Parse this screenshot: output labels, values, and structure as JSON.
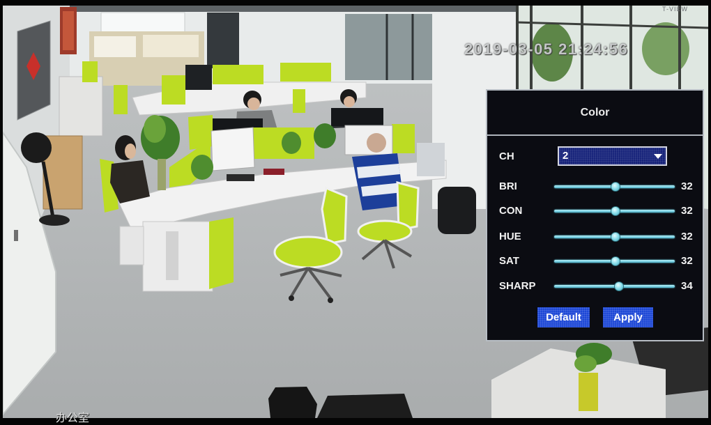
{
  "device": {
    "brand": "T-VIEW"
  },
  "osd": {
    "timestamp": "2019-03-05 21:24:56",
    "channel_name": "办公室"
  },
  "color_panel": {
    "title": "Color",
    "channel": {
      "label": "CH",
      "selected": "2"
    },
    "sliders": [
      {
        "label": "BRI",
        "value": 32
      },
      {
        "label": "CON",
        "value": 32
      },
      {
        "label": "HUE",
        "value": 32
      },
      {
        "label": "SAT",
        "value": 32
      },
      {
        "label": "SHARP",
        "value": 34
      }
    ],
    "buttons": {
      "default": "Default",
      "apply": "Apply"
    }
  },
  "icons": {
    "dropdown": "chevron-down-icon",
    "slider_handle": "slider-knob"
  },
  "colors": {
    "panel_background": "#0b0c12",
    "button_blue": "#1d47d6",
    "dropdown_navy": "#16227a",
    "slider_cyan": "#7ad6e8",
    "partition_lime": "#bcdc23"
  }
}
